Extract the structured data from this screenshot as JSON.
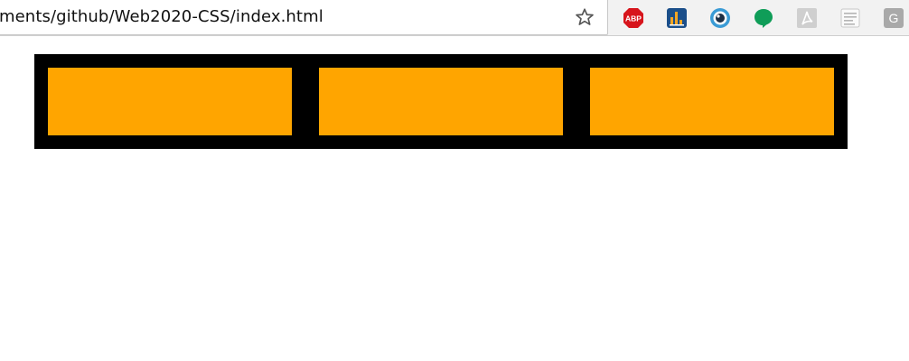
{
  "browser": {
    "url": "ments/github/Web2020-CSS/index.html",
    "bookmark_icon": "star-icon",
    "extensions": [
      {
        "icon": "adblock-plus-icon",
        "label": "ABP"
      },
      {
        "icon": "stats-icon",
        "label": ""
      },
      {
        "icon": "eye-icon",
        "label": ""
      },
      {
        "icon": "chat-bubble-icon",
        "label": ""
      },
      {
        "icon": "pdf-icon",
        "label": ""
      },
      {
        "icon": "reader-icon",
        "label": ""
      },
      {
        "icon": "g-extension-icon",
        "label": "G"
      }
    ]
  },
  "page": {
    "container_color": "#000000",
    "box_color": "#ffa500",
    "boxes": [
      {
        "name": "box-1"
      },
      {
        "name": "box-2"
      },
      {
        "name": "box-3"
      }
    ]
  }
}
